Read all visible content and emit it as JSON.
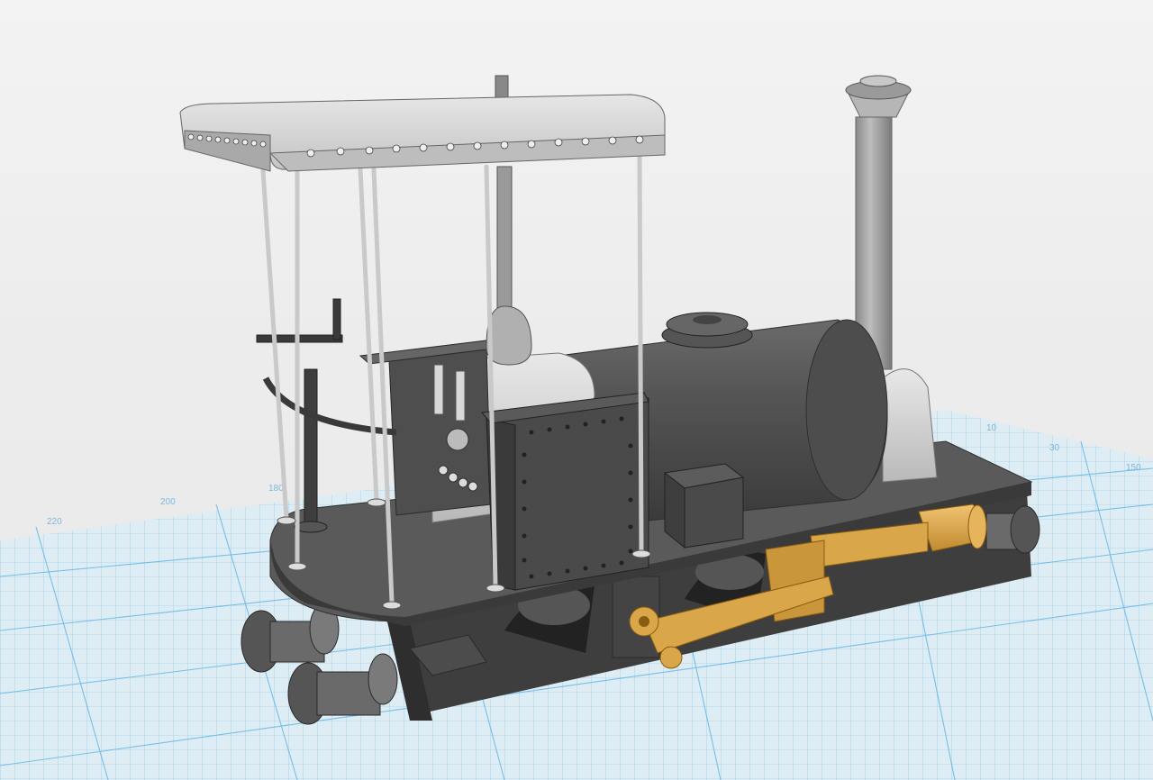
{
  "viewport": {
    "background": "#ececec",
    "grid_color": "#5fb4e4",
    "grid_fill": "#dcecf6"
  },
  "grid_labels": [
    "220",
    "200",
    "180",
    "10",
    "30",
    "150"
  ],
  "model": {
    "parts": [
      "canopy-roof",
      "canopy-post",
      "chimney",
      "smokebox",
      "boiler",
      "dome",
      "saddle-tank",
      "cab-side-sheet",
      "cab-spectacle-plate",
      "tool-box",
      "running-board",
      "frame",
      "buffer",
      "handbrake-column",
      "cylinder",
      "connecting-rod",
      "crosshead",
      "crank"
    ],
    "colors": {
      "body": "#5a5a5a",
      "boiler_light": "#cfcfcf",
      "tank": "#4a4a4a",
      "canopy": "#dcdcdc",
      "brass": "#d9a64a",
      "frame": "#3e3e3e"
    }
  }
}
